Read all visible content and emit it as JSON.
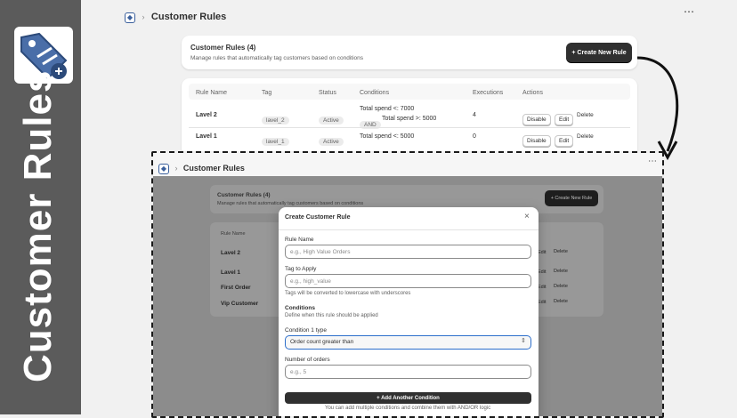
{
  "side_title": "Customer Rules",
  "top": {
    "breadcrumb": "Customer Rules",
    "more": "⋯",
    "card_title": "Customer Rules (4)",
    "card_desc": "Manage rules that automatically tag customers based on conditions",
    "create_btn": "+ Create New Rule",
    "table": {
      "headers": [
        "Rule Name",
        "Tag",
        "Status",
        "Conditions",
        "Executions",
        "Actions"
      ],
      "rows": [
        {
          "name": "Lavel 2",
          "tag": "lavel_2",
          "status": "Active",
          "cond1": "Total spend <: 7000",
          "and": "AND",
          "cond2": "Total spend >: 5000",
          "exec": "4",
          "disable": "Disable",
          "edit": "Edit",
          "delete": "Delete"
        },
        {
          "name": "Lavel 1",
          "tag": "lavel_1",
          "status": "Active",
          "cond1": "Total spend <: 5000",
          "exec": "0",
          "disable": "Disable",
          "edit": "Edit",
          "delete": "Delete"
        }
      ]
    }
  },
  "zoom": {
    "breadcrumb": "Customer Rules",
    "more": "⋯",
    "card_title": "Customer Rules (4)",
    "card_desc": "Manage rules that automatically tag customers based on conditions",
    "create_btn": "+ Create New Rule",
    "table_header": "Rule Name",
    "rows": [
      {
        "name": "Lavel 2",
        "edit": "Edit",
        "delete": "Delete"
      },
      {
        "name": "Lavel 1",
        "edit": "Edit",
        "delete": "Delete"
      },
      {
        "name": "First Order",
        "edit": "Edit",
        "delete": "Delete"
      },
      {
        "name": "Vip Customer",
        "edit": "Edit",
        "delete": "Delete"
      }
    ]
  },
  "modal": {
    "title": "Create Customer Rule",
    "close": "×",
    "rule_name_label": "Rule Name",
    "rule_name_placeholder": "e.g., High Value Orders",
    "tag_label": "Tag to Apply",
    "tag_placeholder": "e.g., high_value",
    "tag_help": "Tags will be converted to lowercase with underscores",
    "conditions_heading": "Conditions",
    "conditions_desc": "Define when this rule should be applied",
    "cond1_label": "Condition 1 type",
    "cond1_value": "Order count greater than",
    "orders_label": "Number of orders",
    "orders_placeholder": "e.g., 5",
    "add_btn": "+ Add Another Condition",
    "add_help": "You can add multiple conditions and combine them with AND/OR logic"
  },
  "colors": {
    "dark": "#303030",
    "accent": "#3a5f9c",
    "band": "#5b5b5b"
  }
}
